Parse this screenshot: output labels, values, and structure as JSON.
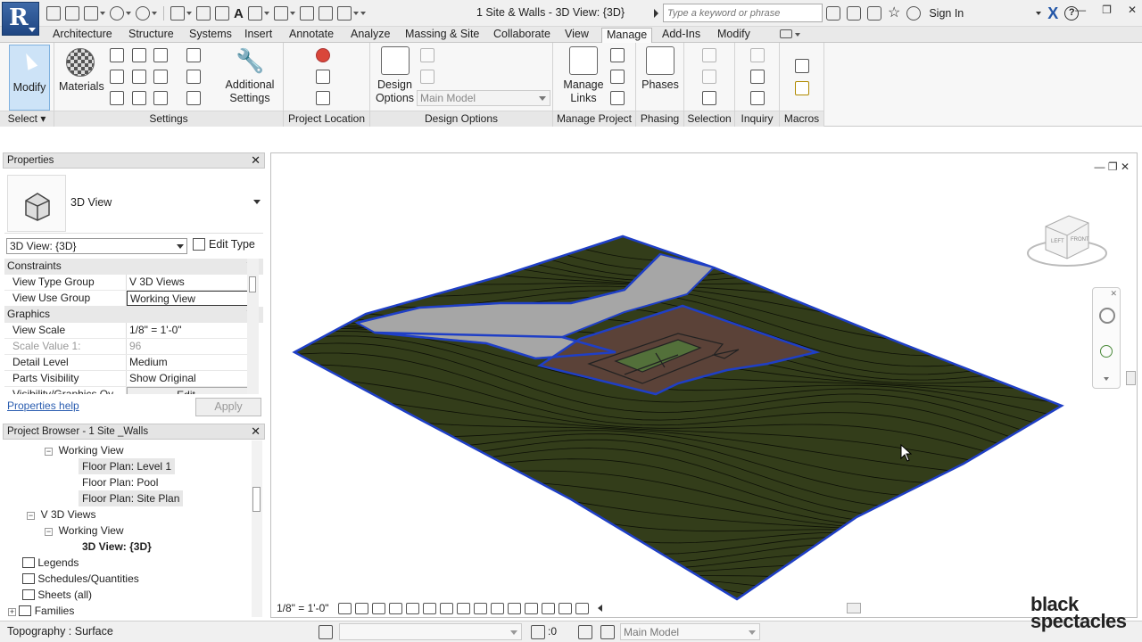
{
  "title_bar": {
    "app_letter": "R",
    "doc_title": "1 Site & Walls - 3D View: {3D}",
    "search_placeholder": "Type a keyword or phrase",
    "sign_in": "Sign In",
    "minimize": "—",
    "restore": "❐",
    "close": "✕"
  },
  "tabs": [
    "Architecture",
    "Structure",
    "Systems",
    "Insert",
    "Annotate",
    "Analyze",
    "Massing & Site",
    "Collaborate",
    "View",
    "Manage",
    "Add-Ins",
    "Modify"
  ],
  "active_tab": "Manage",
  "ribbon": {
    "modify": "Modify",
    "select": "Select",
    "materials": "Materials",
    "additional_settings_1": "Additional",
    "additional_settings_2": "Settings",
    "settings_label": "Settings",
    "project_location_label": "Project Location",
    "design_options_1": "Design",
    "design_options_2": "Options",
    "main_model_combo": "Main Model",
    "design_options_label": "Design Options",
    "manage_links_1": "Manage",
    "manage_links_2": "Links",
    "manage_project_label": "Manage Project",
    "phases": "Phases",
    "phasing_label": "Phasing",
    "selection_label": "Selection",
    "inquiry_label": "Inquiry",
    "macros_label": "Macros"
  },
  "properties": {
    "header": "Properties",
    "type_name": "3D View",
    "instance_selector": "3D View: {3D}",
    "edit_type": "Edit Type",
    "groups": {
      "constraints": "Constraints",
      "graphics": "Graphics"
    },
    "rows": [
      {
        "k": "View Type Group",
        "v": "V 3D Views"
      },
      {
        "k": "View Use Group",
        "v": "Working View"
      },
      {
        "k": "View Scale",
        "v": "1/8\" = 1'-0\""
      },
      {
        "k": "Scale Value    1:",
        "v": "96"
      },
      {
        "k": "Detail Level",
        "v": "Medium"
      },
      {
        "k": "Parts Visibility",
        "v": "Show Original"
      },
      {
        "k": "Visibility/Graphics Ov...",
        "v": "Edit..."
      }
    ],
    "help": "Properties help",
    "apply": "Apply"
  },
  "project_browser": {
    "header": "Project Browser - 1 Site _Walls",
    "nodes": [
      "Working View",
      "Floor Plan: Level 1",
      "Floor Plan: Pool",
      "Floor Plan: Site Plan",
      "V 3D Views",
      "Working View",
      "3D View: {3D}",
      "Legends",
      "Schedules/Quantities",
      "Sheets (all)",
      "Families"
    ]
  },
  "viewport": {
    "cube_left": "LEFT",
    "cube_front": "FRONT",
    "scale": "1/8\" = 1'-0\"",
    "colors": {
      "terrain": "#333d1a",
      "boundary": "#1f3fc6",
      "road": "#a6a6a6",
      "pad": "#5b4238"
    }
  },
  "status": {
    "text": "Topography : Surface",
    "zero": ":0",
    "model": "Main Model"
  },
  "watermark": {
    "line1": "black",
    "line2": "spectacles"
  }
}
